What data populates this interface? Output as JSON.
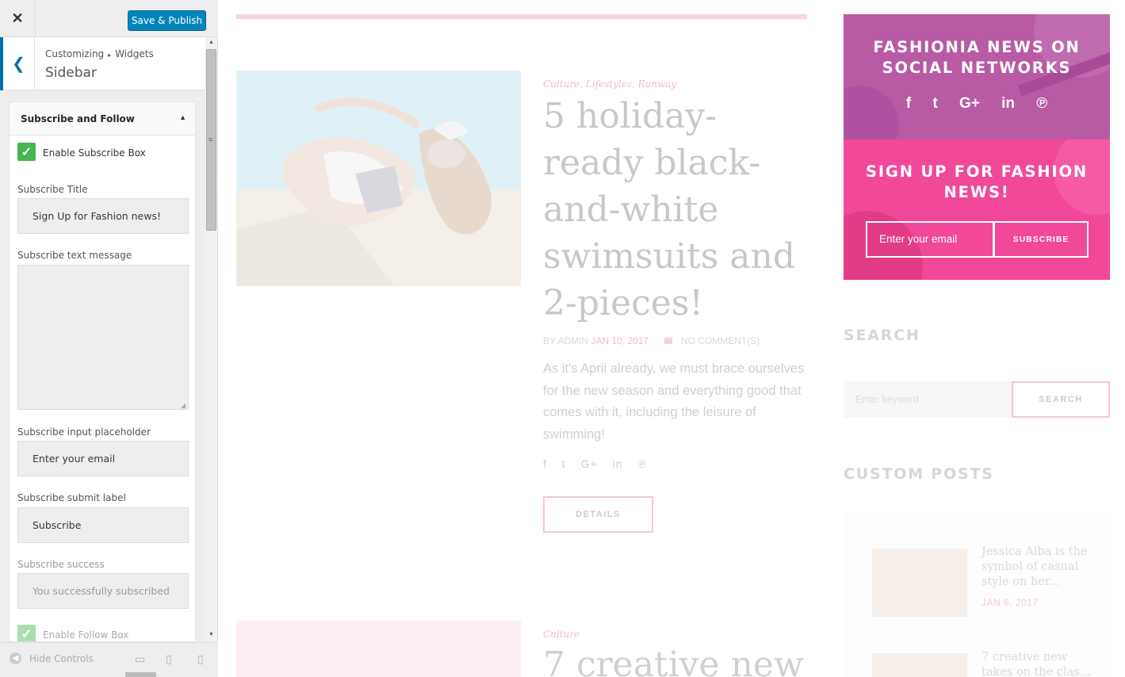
{
  "controls": {
    "close_icon": "close-icon",
    "save_label": "Save & Publish",
    "breadcrumb_root": "Customizing",
    "breadcrumb_sep": "▸",
    "breadcrumb_child": "Widgets",
    "section_title": "Sidebar",
    "widget_title": "Subscribe and Follow",
    "enable_subscribe_label": "Enable Subscribe Box",
    "enable_subscribe_checked": true,
    "subscribe_title_label": "Subscribe Title",
    "subscribe_title_value": "Sign Up for Fashion news!",
    "subscribe_text_label": "Subscribe text message",
    "subscribe_text_value": "",
    "placeholder_label": "Subscribe input placeholder",
    "placeholder_value": "Enter your email",
    "submit_label_label": "Subscribe submit label",
    "submit_label_value": "Subscribe",
    "success_label": "Subscribe success",
    "success_value": "You successfully subscribed",
    "enable_follow_label": "Enable Follow Box",
    "enable_follow_checked": true,
    "hide_controls_label": "Hide Controls"
  },
  "preview": {
    "post1": {
      "categories": "Culture, Lifestyles, Runway",
      "title": "5 holiday-ready black-and-white swimsuits and 2-pieces!",
      "meta_by": "BY ADMIN",
      "meta_date": "JAN 10, 2017",
      "meta_comments": "NO COMMENT(S)",
      "excerpt": "As it's April already, we must brace ourselves for the new season and everything good that comes with it, including the leisure of swimming!",
      "details_label": "DETAILS"
    },
    "post2": {
      "categories": "Culture",
      "title": "7 creative new"
    },
    "social_widget": {
      "title": "FASHIONIA NEWS ON SOCIAL NETWORKS",
      "icons": [
        "facebook-icon",
        "twitter-icon",
        "google-plus-icon",
        "linkedin-icon",
        "pinterest-icon"
      ]
    },
    "signup_widget": {
      "title": "SIGN UP FOR FASHION NEWS!",
      "input_placeholder": "Enter your email",
      "button_label": "SUBSCRIBE"
    },
    "search_widget": {
      "title": "SEARCH",
      "placeholder": "Enter keyword",
      "button_label": "SEARCH"
    },
    "custom_posts": {
      "title": "CUSTOM POSTS",
      "items": [
        {
          "title": "Jessica Alba is the symbol of casual style on her...",
          "date": "JAN 6, 2017"
        },
        {
          "title": "7 creative new takes on the clas...",
          "date": ""
        }
      ]
    },
    "colors": {
      "accent_blue": "#0085ba",
      "checkbox_green": "#46b450",
      "social_purple": "#b85aa4",
      "signup_pink": "#f2489a"
    }
  }
}
